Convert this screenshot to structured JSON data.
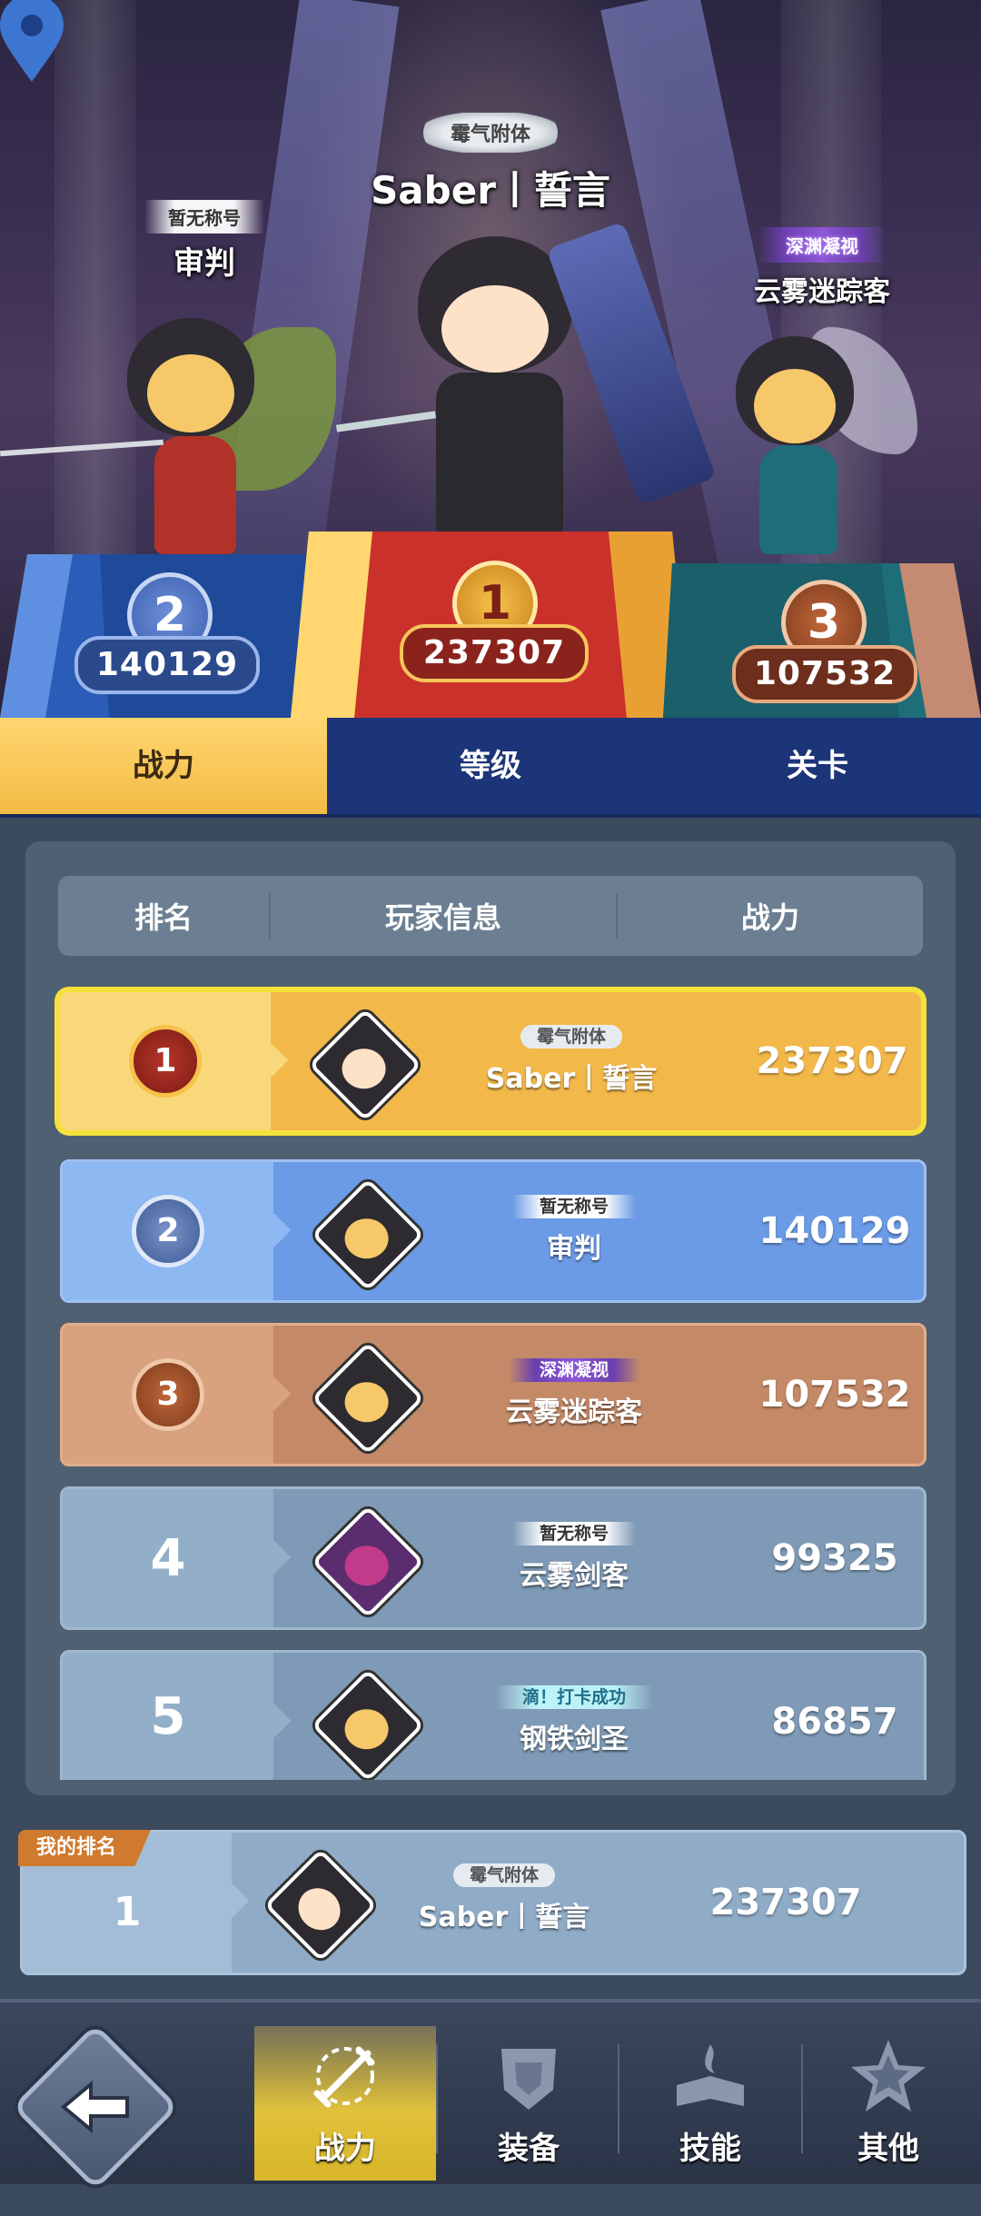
{
  "podium": {
    "first": {
      "title_badge": "霉气附体",
      "name": "Saber丨誓言",
      "rank": "1",
      "score": "237307"
    },
    "second": {
      "title_badge": "暂无称号",
      "name": "审判",
      "rank": "2",
      "score": "140129"
    },
    "third": {
      "title_badge": "深渊凝视",
      "name": "云雾迷踪客",
      "rank": "3",
      "score": "107532"
    }
  },
  "tabs": [
    "战力",
    "等级",
    "关卡"
  ],
  "table": {
    "headers": [
      "排名",
      "玩家信息",
      "战力"
    ],
    "rows": [
      {
        "rank": "1",
        "title_badge": "霉气附体",
        "name": "Saber丨誓言",
        "power": "237307"
      },
      {
        "rank": "2",
        "title_badge": "暂无称号",
        "name": "审判",
        "power": "140129"
      },
      {
        "rank": "3",
        "title_badge": "深渊凝视",
        "name": "云雾迷踪客",
        "power": "107532"
      },
      {
        "rank": "4",
        "title_badge": "暂无称号",
        "name": "云雾剑客",
        "power": "99325"
      },
      {
        "rank": "5",
        "title_badge": "滴！打卡成功",
        "name": "钢铁剑圣",
        "power": "86857"
      }
    ]
  },
  "my_rank": {
    "label": "我的排名",
    "rank": "1",
    "title_badge": "霉气附体",
    "name": "Saber丨誓言",
    "power": "237307"
  },
  "bottom_nav": [
    "战力",
    "装备",
    "技能",
    "其他"
  ],
  "colors": {
    "gold": "#f3bb45",
    "blue_row": "#6b9be6",
    "bronze_row": "#c48a68",
    "navy_tab": "#1c3478"
  }
}
